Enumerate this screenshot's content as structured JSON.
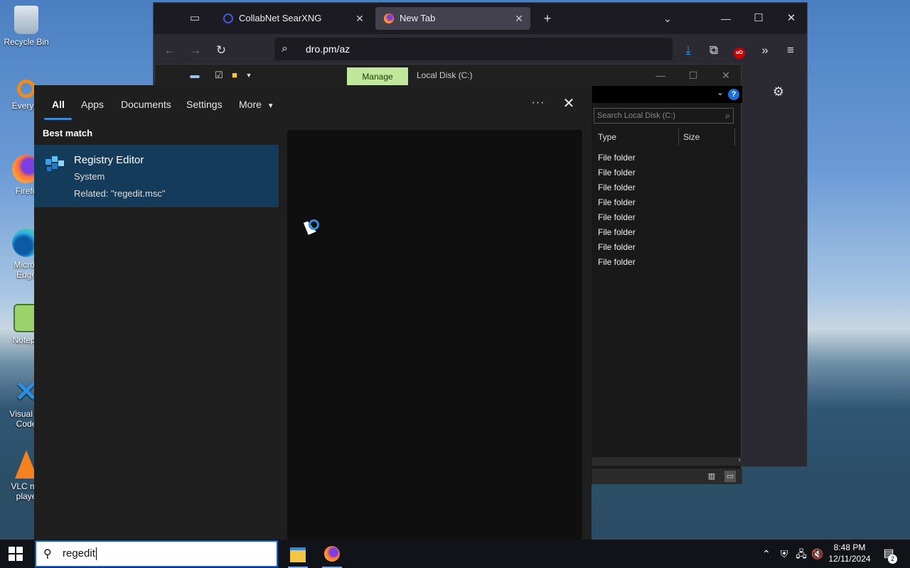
{
  "desktop": {
    "icons": [
      {
        "label": "Recycle Bin",
        "icon": "recycle-bin-icon"
      },
      {
        "label": "Everyth",
        "icon": "everything-search-icon"
      },
      {
        "label": "Firefo",
        "icon": "firefox-icon"
      },
      {
        "label": "Micros\nEdge",
        "icon": "edge-icon"
      },
      {
        "label": "Notepa",
        "icon": "notepad-icon"
      },
      {
        "label": "Visual St\nCode",
        "icon": "vscode-icon"
      },
      {
        "label": "VLC me\nplaye",
        "icon": "vlc-icon"
      }
    ]
  },
  "browser": {
    "tabs": [
      {
        "label": "CollabNet SearXNG",
        "icon": "searxng-icon"
      },
      {
        "label": "New Tab",
        "icon": "firefox-icon",
        "active": true
      }
    ],
    "url": "dro.pm/az",
    "colors": {
      "tabbar": "#1c1b22",
      "toolbar": "#2b2a33",
      "accent": "#2a8fe0"
    }
  },
  "explorer": {
    "manage_label": "Manage",
    "title": "Local Disk (C:)",
    "search_placeholder": "Search Local Disk (C:)",
    "columns": [
      "Type",
      "Size"
    ],
    "rows": [
      "File folder",
      "File folder",
      "File folder",
      "File folder",
      "File folder",
      "File folder",
      "File folder",
      "File folder"
    ]
  },
  "search": {
    "tabs": [
      "All",
      "Apps",
      "Documents",
      "Settings",
      "More"
    ],
    "best_match_label": "Best match",
    "result": {
      "title": "Registry Editor",
      "subtitle": "System",
      "related": "Related: \"regedit.msc\""
    },
    "query": "regedit"
  },
  "taskbar": {
    "time": "8:48 PM",
    "date": "12/11/2024",
    "notification_count": "2"
  }
}
